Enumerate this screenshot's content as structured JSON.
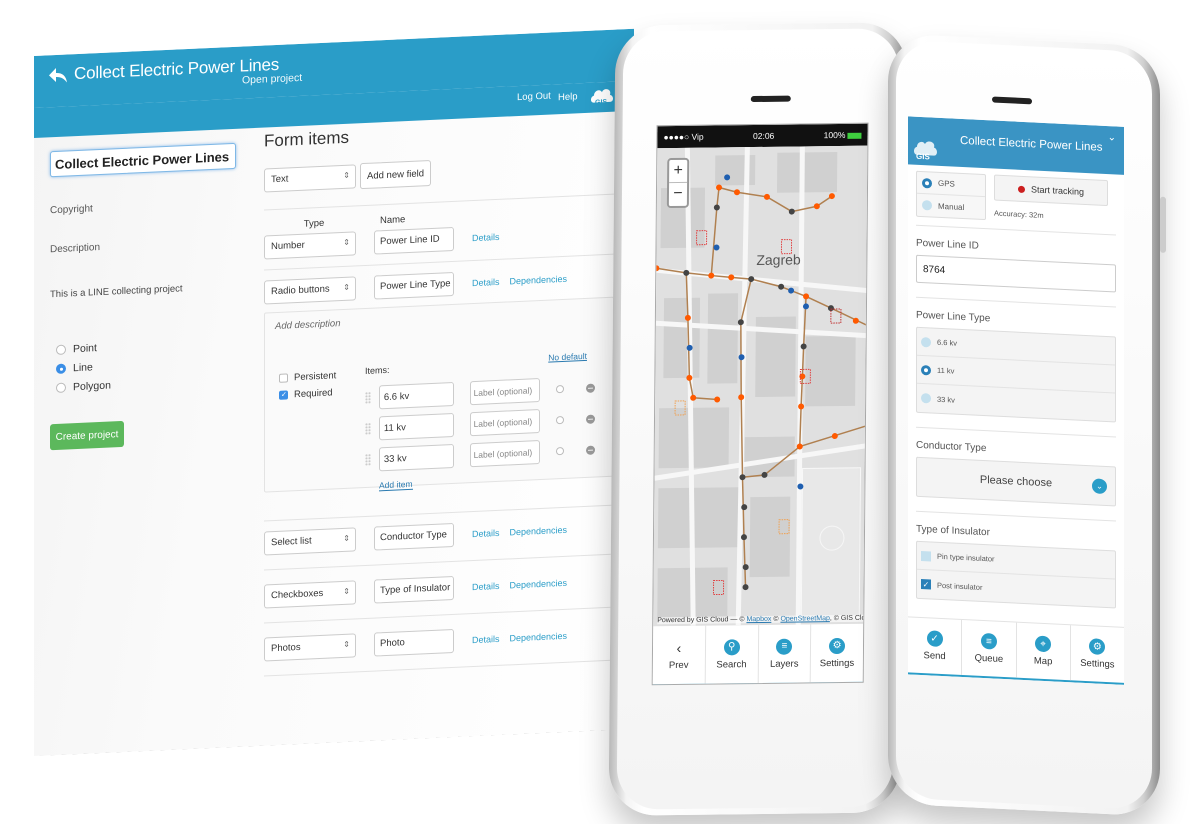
{
  "desktop": {
    "header": {
      "title": "Collect Electric Power Lines",
      "open_project": "Open project",
      "logout": "Log Out",
      "help": "Help",
      "logo_text": "GIS"
    },
    "left": {
      "project_name": "Collect Electric Power Lines",
      "copyright_label": "Copyright",
      "description_label": "Description",
      "description_text": "This is a LINE collecting project",
      "geometry_options": [
        {
          "label": "Point",
          "checked": false
        },
        {
          "label": "Line",
          "checked": true
        },
        {
          "label": "Polygon",
          "checked": false
        }
      ],
      "create_button": "Create project"
    },
    "form": {
      "title": "Form items",
      "new_field_type": "Text",
      "add_field_button": "Add new field",
      "col_type": "Type",
      "col_name": "Name",
      "fields": [
        {
          "type": "Number",
          "name": "Power Line ID",
          "details": "Details",
          "dependencies": ""
        },
        {
          "type": "Radio buttons",
          "name": "Power Line Type",
          "details": "Details",
          "dependencies": "Dependencies"
        },
        {
          "type": "Select list",
          "name": "Conductor Type",
          "details": "Details",
          "dependencies": "Dependencies"
        },
        {
          "type": "Checkboxes",
          "name": "Type of Insulator",
          "details": "Details",
          "dependencies": "Dependencies"
        },
        {
          "type": "Photos",
          "name": "Photo",
          "details": "Details",
          "dependencies": "Dependencies"
        }
      ],
      "expanded": {
        "add_description": "Add description",
        "persistent": "Persistent",
        "persistent_checked": false,
        "required": "Required",
        "required_checked": true,
        "items_label": "Items:",
        "no_default": "No default",
        "label_placeholder": "Label (optional)",
        "items": [
          "6.6 kv",
          "11 kv",
          "33 kv"
        ],
        "add_item": "Add item"
      }
    }
  },
  "phone_map": {
    "status": {
      "carrier": "●●●●○ Vip",
      "time": "02:06",
      "battery": "100%"
    },
    "zoom_in": "+",
    "zoom_out": "−",
    "city_label": "Zagreb",
    "attribution": {
      "prefix": "Powered by GIS Cloud — ©",
      "mapbox": "Mapbox",
      "sep": "©",
      "osm": "OpenStreetMap",
      "suffix": ", © GIS Cloud"
    },
    "tabs": [
      {
        "label": "Prev",
        "icon": "chevron-left-icon",
        "glyph": "‹"
      },
      {
        "label": "Search",
        "icon": "search-icon",
        "glyph": "⚲"
      },
      {
        "label": "Layers",
        "icon": "layers-icon",
        "glyph": "≡"
      },
      {
        "label": "Settings",
        "icon": "gear-icon",
        "glyph": "⚙"
      }
    ]
  },
  "phone_form": {
    "header_title": "Collect Electric Power Lines",
    "logo_text": "GIS",
    "gps_label": "GPS",
    "manual_label": "Manual",
    "gps_selected": "GPS",
    "start_tracking": "Start tracking",
    "accuracy": "Accuracy: 32m",
    "power_line_id_label": "Power Line ID",
    "power_line_id_value": "8764",
    "power_line_type_label": "Power Line Type",
    "power_line_type_options": [
      {
        "label": "6.6 kv",
        "selected": false
      },
      {
        "label": "11 kv",
        "selected": true
      },
      {
        "label": "33 kv",
        "selected": false
      }
    ],
    "conductor_type_label": "Conductor Type",
    "conductor_type_value": "Please choose",
    "insulator_label": "Type of Insulator",
    "insulator_options": [
      {
        "label": "Pin type insulator",
        "checked": false
      },
      {
        "label": "Post insulator",
        "checked": true
      }
    ],
    "tabs": [
      {
        "label": "Send",
        "icon": "check-icon",
        "glyph": "✓"
      },
      {
        "label": "Queue",
        "icon": "list-icon",
        "glyph": "≡"
      },
      {
        "label": "Map",
        "icon": "map-pin-icon",
        "glyph": "⌖"
      },
      {
        "label": "Settings",
        "icon": "gear-icon",
        "glyph": "⚙"
      }
    ]
  },
  "colors": {
    "brand_blue": "#2a9dc8",
    "create_green": "#5cb85c",
    "tracking_red": "#cc1f1f",
    "line_orange": "#ff5a00"
  }
}
